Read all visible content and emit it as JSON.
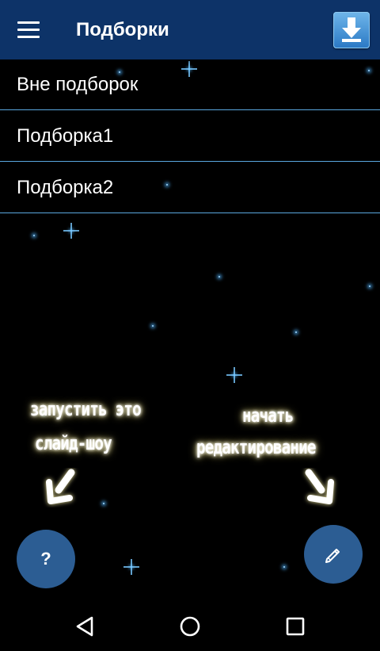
{
  "app_bar": {
    "title": "Подборки",
    "menu_icon": "menu-icon",
    "download_icon": "download-arrow-icon"
  },
  "collections": [
    {
      "label": "Вне подборок"
    },
    {
      "label": "Подборка1"
    },
    {
      "label": "Подборка2"
    }
  ],
  "hints": {
    "left_line1": "запустить это",
    "left_line2": "слайд-шоу",
    "right_line1": "начать",
    "right_line2": "редактирование"
  },
  "fabs": {
    "help_label": "?",
    "edit_icon": "pencil-icon"
  },
  "nav": {
    "back_icon": "back-triangle-icon",
    "home_icon": "home-circle-icon",
    "recents_icon": "recents-square-icon"
  },
  "colors": {
    "app_bar": "#0d3368",
    "divider": "#5aa8e0",
    "fab": "#2c5d93",
    "background": "#000000"
  }
}
